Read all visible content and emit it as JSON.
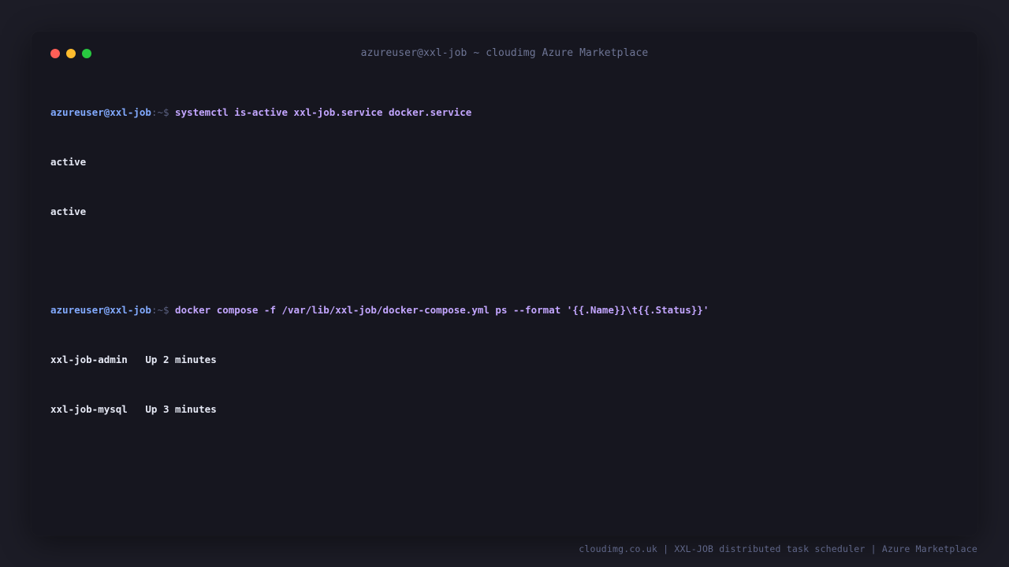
{
  "window": {
    "title": "azureuser@xxl-job ~ cloudimg Azure Marketplace"
  },
  "terminal": {
    "blocks": [
      {
        "prompt_user": "azureuser@xxl-job",
        "prompt_sep": ":~$",
        "command": "systemctl is-active xxl-job.service docker.service",
        "output": [
          "active",
          "active"
        ]
      },
      {
        "prompt_user": "azureuser@xxl-job",
        "prompt_sep": ":~$",
        "command": "docker compose -f /var/lib/xxl-job/docker-compose.yml ps --format '{{.Name}}\\t{{.Status}}'",
        "output": [
          "xxl-job-admin   Up 2 minutes",
          "xxl-job-mysql   Up 3 minutes"
        ]
      }
    ]
  },
  "footer": {
    "text": "cloudimg.co.uk | XXL-JOB distributed task scheduler | Azure Marketplace"
  },
  "colors": {
    "background": "#1c1c26",
    "window": "#16161f",
    "prompt": "#82aaff",
    "command": "#c3a6ff",
    "output": "#e6e9f5",
    "traffic_red": "#ff5f57",
    "traffic_yellow": "#febc2e",
    "traffic_green": "#28c840"
  }
}
